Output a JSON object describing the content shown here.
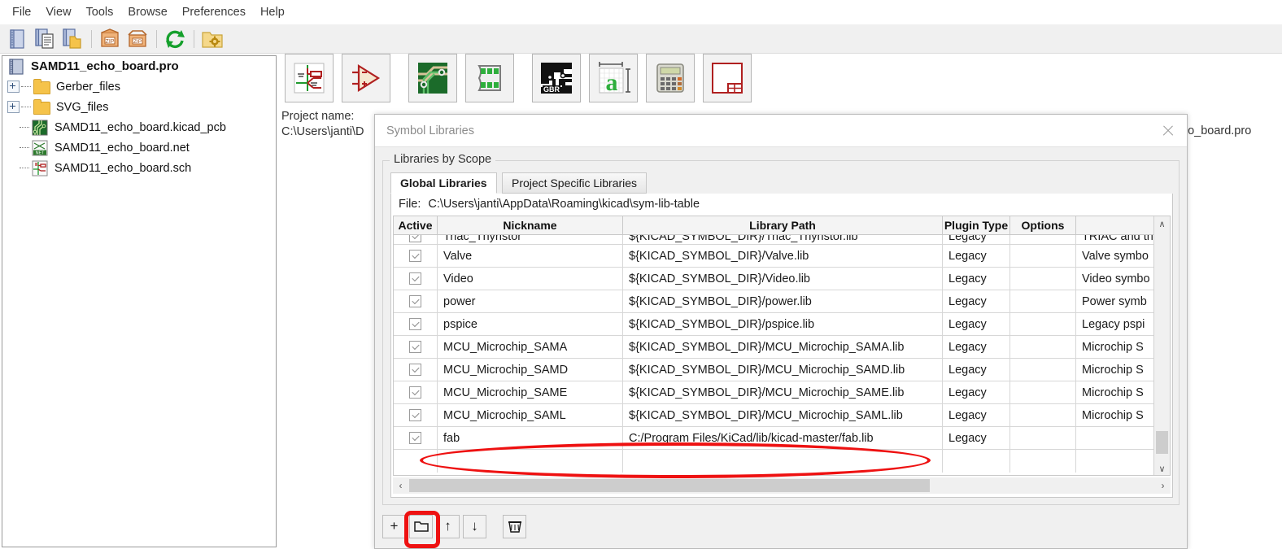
{
  "menubar": {
    "items": [
      {
        "label": "File"
      },
      {
        "label": "View"
      },
      {
        "label": "Tools"
      },
      {
        "label": "Browse"
      },
      {
        "label": "Preferences"
      },
      {
        "label": "Help"
      }
    ]
  },
  "main_toolbar": {
    "buttons": [
      {
        "name": "new-project-icon",
        "tooltip": "New Project"
      },
      {
        "name": "new-project-from-template-icon",
        "tooltip": "New Project from Template"
      },
      {
        "name": "open-project-icon",
        "tooltip": "Open Project"
      },
      {
        "name": "archive-project-zip-icon",
        "tooltip": "Archive Project",
        "badge": "ZIP"
      },
      {
        "name": "unarchive-project-zip-icon",
        "tooltip": "Unarchive Project",
        "badge": "ZIP"
      },
      {
        "name": "refresh-icon",
        "tooltip": "Refresh Project Tree"
      },
      {
        "name": "project-settings-icon",
        "tooltip": "Edit Project Settings"
      }
    ]
  },
  "project_tree": {
    "root": {
      "label": "SAMD11_echo_board.pro",
      "icon": "project-icon"
    },
    "items": [
      {
        "label": "Gerber_files",
        "icon": "folder-icon",
        "expandable": true
      },
      {
        "label": "SVG_files",
        "icon": "folder-icon",
        "expandable": true
      },
      {
        "label": "SAMD11_echo_board.kicad_pcb",
        "icon": "pcb-icon",
        "expandable": false
      },
      {
        "label": "SAMD11_echo_board.net",
        "icon": "netlist-icon",
        "expandable": false
      },
      {
        "label": "SAMD11_echo_board.sch",
        "icon": "schematic-icon",
        "expandable": false
      }
    ]
  },
  "launcher": {
    "buttons": [
      {
        "name": "eeschema-icon",
        "tooltip": "Schematic Layout Editor"
      },
      {
        "name": "symbol-editor-icon",
        "tooltip": "Symbol Editor"
      },
      {
        "name": "pcbnew-icon",
        "tooltip": "PCB Layout Editor"
      },
      {
        "name": "footprint-editor-icon",
        "tooltip": "Footprint Editor"
      },
      {
        "name": "gerbview-icon",
        "tooltip": "Gerber Viewer"
      },
      {
        "name": "bitmap2component-icon",
        "tooltip": "Image Converter"
      },
      {
        "name": "pcb-calculator-icon",
        "tooltip": "Calculator Tools"
      },
      {
        "name": "pl-editor-icon",
        "tooltip": "Worksheet Layout Editor"
      }
    ]
  },
  "workarea": {
    "project_name_label": "Project name:",
    "project_path_clipped": "C:\\Users\\janti\\D",
    "project_path_right_fragment": "ho_board.pro"
  },
  "dialog": {
    "title": "Symbol Libraries",
    "close_label": "✕",
    "groupbox_title": "Libraries by Scope",
    "tabs": [
      {
        "label": "Global Libraries",
        "active": true
      },
      {
        "label": "Project Specific Libraries",
        "active": false
      }
    ],
    "file_label": "File:",
    "file_path": "C:\\Users\\janti\\AppData\\Roaming\\kicad\\sym-lib-table",
    "table": {
      "columns": [
        "Active",
        "Nickname",
        "Library Path",
        "Plugin Type",
        "Options",
        ""
      ],
      "rows": [
        {
          "active": true,
          "nickname": "Triac_Thyristor",
          "path": "${KICAD_SYMBOL_DIR}/Triac_Thyristor.lib",
          "plugin": "Legacy",
          "options": "",
          "description": "TRIAC and th"
        },
        {
          "active": true,
          "nickname": "Valve",
          "path": "${KICAD_SYMBOL_DIR}/Valve.lib",
          "plugin": "Legacy",
          "options": "",
          "description": "Valve symbo"
        },
        {
          "active": true,
          "nickname": "Video",
          "path": "${KICAD_SYMBOL_DIR}/Video.lib",
          "plugin": "Legacy",
          "options": "",
          "description": "Video symbo"
        },
        {
          "active": true,
          "nickname": "power",
          "path": "${KICAD_SYMBOL_DIR}/power.lib",
          "plugin": "Legacy",
          "options": "",
          "description": "Power symb"
        },
        {
          "active": true,
          "nickname": "pspice",
          "path": "${KICAD_SYMBOL_DIR}/pspice.lib",
          "plugin": "Legacy",
          "options": "",
          "description": "Legacy pspi"
        },
        {
          "active": true,
          "nickname": "MCU_Microchip_SAMA",
          "path": "${KICAD_SYMBOL_DIR}/MCU_Microchip_SAMA.lib",
          "plugin": "Legacy",
          "options": "",
          "description": "Microchip S"
        },
        {
          "active": true,
          "nickname": "MCU_Microchip_SAMD",
          "path": "${KICAD_SYMBOL_DIR}/MCU_Microchip_SAMD.lib",
          "plugin": "Legacy",
          "options": "",
          "description": "Microchip S"
        },
        {
          "active": true,
          "nickname": "MCU_Microchip_SAME",
          "path": "${KICAD_SYMBOL_DIR}/MCU_Microchip_SAME.lib",
          "plugin": "Legacy",
          "options": "",
          "description": "Microchip S"
        },
        {
          "active": true,
          "nickname": "MCU_Microchip_SAML",
          "path": "${KICAD_SYMBOL_DIR}/MCU_Microchip_SAML.lib",
          "plugin": "Legacy",
          "options": "",
          "description": "Microchip S"
        },
        {
          "active": true,
          "nickname": "fab",
          "path": "C:/Program Files/KiCad/lib/kicad-master/fab.lib",
          "plugin": "Legacy",
          "options": "",
          "description": ""
        }
      ]
    },
    "scrollbars": {
      "vertical_up": "∧",
      "vertical_down": "∨",
      "horizontal_left": "‹",
      "horizontal_right": "›"
    },
    "bottom_buttons": [
      {
        "name": "append-library-button",
        "glyph": "+",
        "tooltip": "Add empty row to table"
      },
      {
        "name": "browse-library-button",
        "glyph": "folder",
        "tooltip": "Add existing library to table",
        "highlighted": true
      },
      {
        "name": "move-up-button",
        "glyph": "↑",
        "tooltip": "Move up"
      },
      {
        "name": "move-down-button",
        "glyph": "↓",
        "tooltip": "Move down"
      },
      {
        "name": "delete-library-button",
        "glyph": "trash",
        "tooltip": "Remove library from table"
      }
    ]
  },
  "annotations": {
    "accent_color": "#ee1111",
    "highlights": [
      {
        "name": "fab-row-highlight",
        "target": "fab row in library table"
      },
      {
        "name": "browse-button-highlight",
        "target": "browse library button"
      }
    ]
  }
}
